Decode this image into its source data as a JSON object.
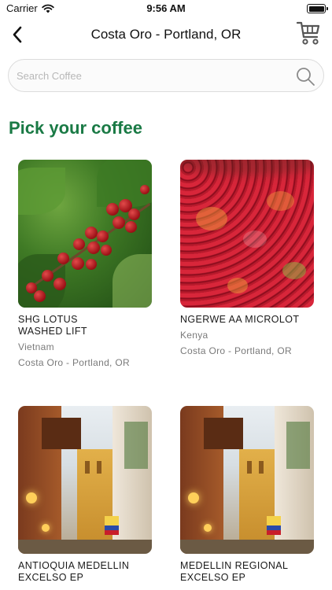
{
  "status": {
    "carrier": "Carrier",
    "time": "9:56 AM"
  },
  "nav": {
    "title": "Costa Oro - Portland, OR"
  },
  "search": {
    "placeholder": "Search Coffee",
    "value": ""
  },
  "heading": "Pick your coffee",
  "coffees": [
    {
      "name": "SHG LOTUS\nWASHED LIFT",
      "origin": "Vietnam",
      "roaster": "Costa Oro - Portland, OR"
    },
    {
      "name": "NGERWE AA MICROLOT",
      "origin": "Kenya",
      "roaster": "Costa Oro - Portland, OR"
    },
    {
      "name": "ANTIOQUIA MEDELLIN\nEXCELSO EP",
      "origin": "",
      "roaster": ""
    },
    {
      "name": "MEDELLIN REGIONAL\nEXCELSO EP",
      "origin": "",
      "roaster": ""
    }
  ],
  "colors": {
    "accent": "#1a7a45"
  },
  "icons": {
    "back": "chevron-left-icon",
    "cart": "cart-icon",
    "search": "search-icon",
    "wifi": "wifi-icon",
    "battery": "battery-icon"
  }
}
